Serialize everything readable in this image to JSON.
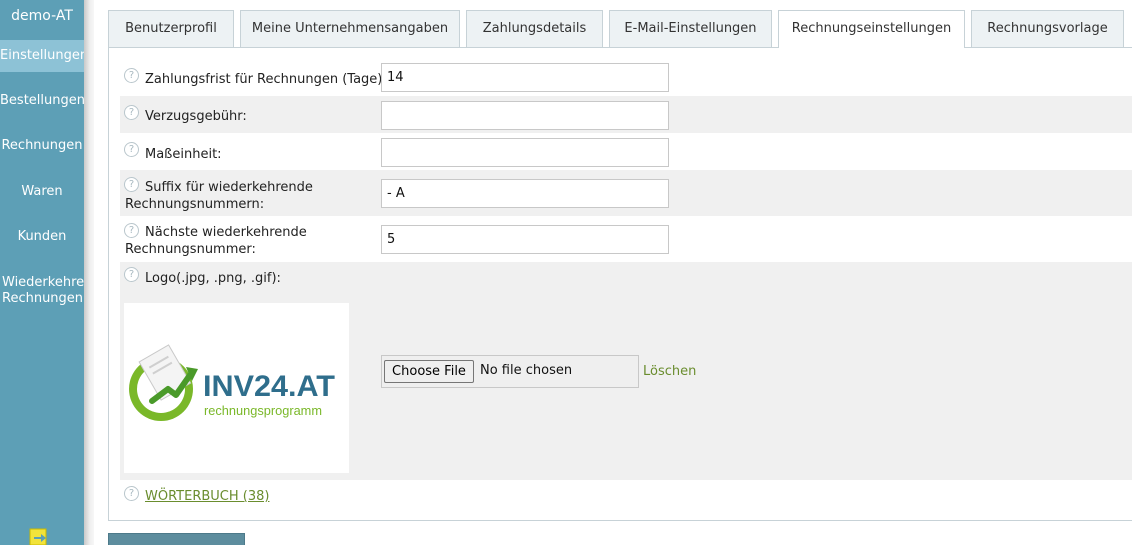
{
  "sidebar": {
    "company": "demo-AT",
    "items": [
      {
        "label": "Einstellungen",
        "active": true
      },
      {
        "label": "Bestellungen"
      },
      {
        "label": "Rechnungen"
      },
      {
        "label": "Waren"
      },
      {
        "label": "Kunden"
      },
      {
        "label": "Wiederkehrende",
        "label2": "Rechnungen"
      }
    ],
    "exit_icon": "exit-icon"
  },
  "tabs": [
    {
      "label": "Benutzerprofil"
    },
    {
      "label": "Meine Unternehmensangaben"
    },
    {
      "label": "Zahlungsdetails"
    },
    {
      "label": "E-Mail-Einstellungen"
    },
    {
      "label": "Rechnungseinstellungen",
      "active": true
    },
    {
      "label": "Rechnungsvorlage"
    }
  ],
  "form": {
    "payment_term": {
      "label": "Zahlungsfrist für Rechnungen (Tage):",
      "value": "14"
    },
    "late_fee": {
      "label": "Verzugsgebühr:",
      "value": ""
    },
    "unit": {
      "label": "Maßeinheit:",
      "value": ""
    },
    "suffix": {
      "label_line1": "Suffix für wiederkehrende",
      "label_line2": "Rechnungsnummern:",
      "value": "- A"
    },
    "next_number": {
      "label_line1": "Nächste wiederkehrende",
      "label_line2": "Rechnungsnummer:",
      "value": "5"
    },
    "logo": {
      "label": "Logo(.jpg, .png, .gif):"
    }
  },
  "logo_image": {
    "brand": "INV24.AT",
    "tagline": "rechnungsprogramm",
    "colors": {
      "green": "#7ab829",
      "blue": "#2f6e8c"
    }
  },
  "file_input": {
    "button_label": "Choose File",
    "status": "No file chosen"
  },
  "delete_label": "Löschen",
  "dictionary_link": "WÖRTERBUCH (38)",
  "colors": {
    "sidebar": "#5d9fb6",
    "sidebar_active": "#8dc2d6",
    "link": "#6a8d2e"
  }
}
